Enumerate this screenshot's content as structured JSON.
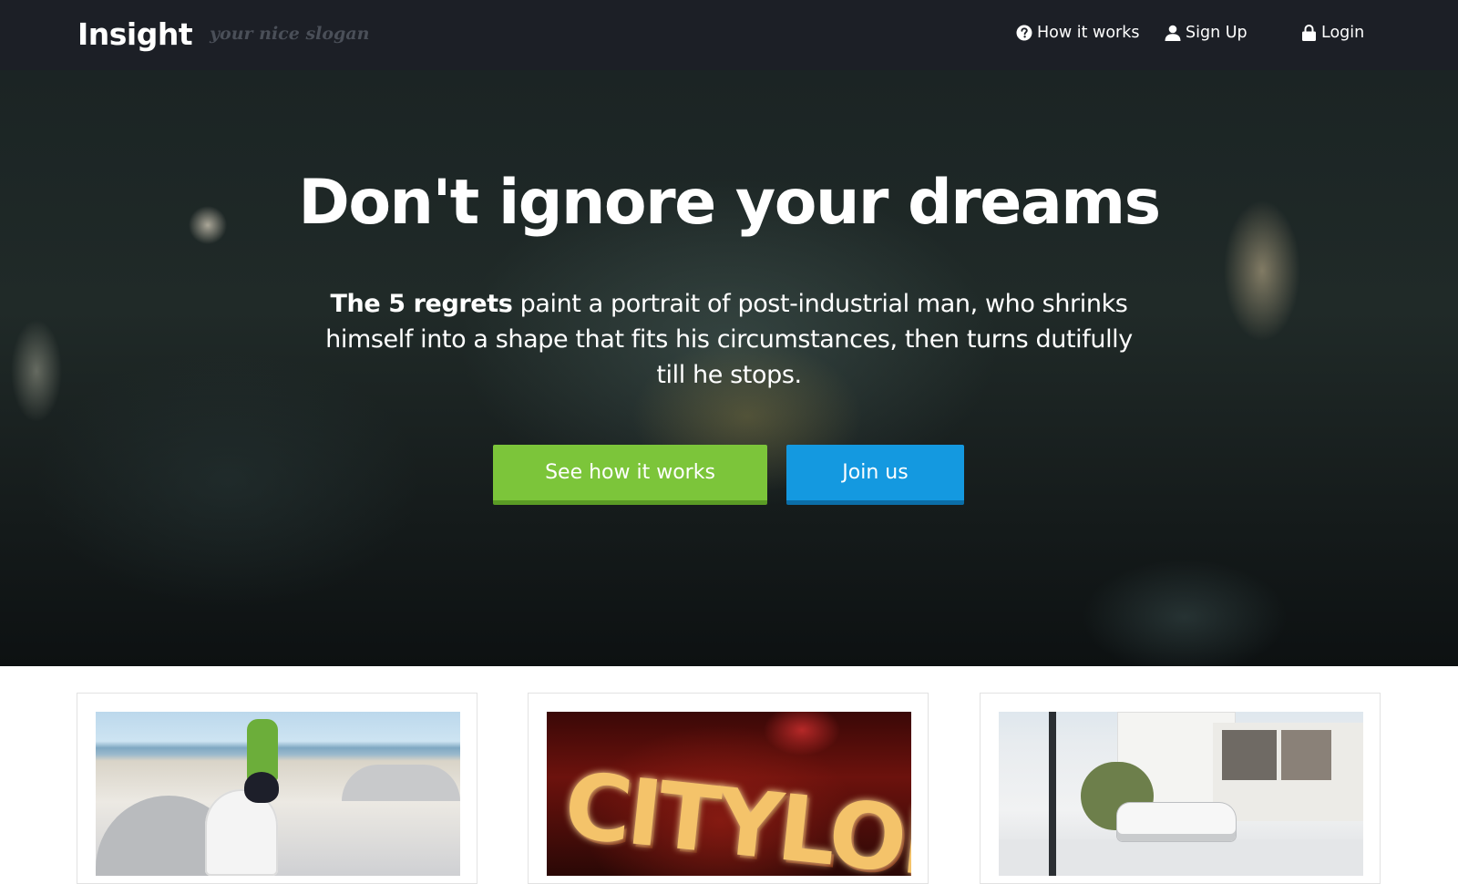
{
  "navbar": {
    "brand": "Insight",
    "slogan": "your nice slogan",
    "links": [
      {
        "label": "How it works",
        "icon": "question-circle-icon"
      },
      {
        "label": "Sign Up",
        "icon": "user-icon"
      },
      {
        "label": "Login",
        "icon": "lock-icon"
      }
    ]
  },
  "hero": {
    "title": "Don't ignore your dreams",
    "text_bold": "The 5 regrets",
    "text_rest": " paint a portrait of post-industrial man, who shrinks himself into a shape that fits his circumstances, then turns dutifully till he stops.",
    "buttons": {
      "primary": "See how it works",
      "secondary": "Join us"
    }
  },
  "cards": [
    {
      "image_text": ""
    },
    {
      "image_text": "CITYLOFT"
    },
    {
      "image_text": ""
    }
  ],
  "colors": {
    "navbar_bg": "#1c1f26",
    "green_button": "#7cc53a",
    "blue_button": "#1499e0"
  }
}
